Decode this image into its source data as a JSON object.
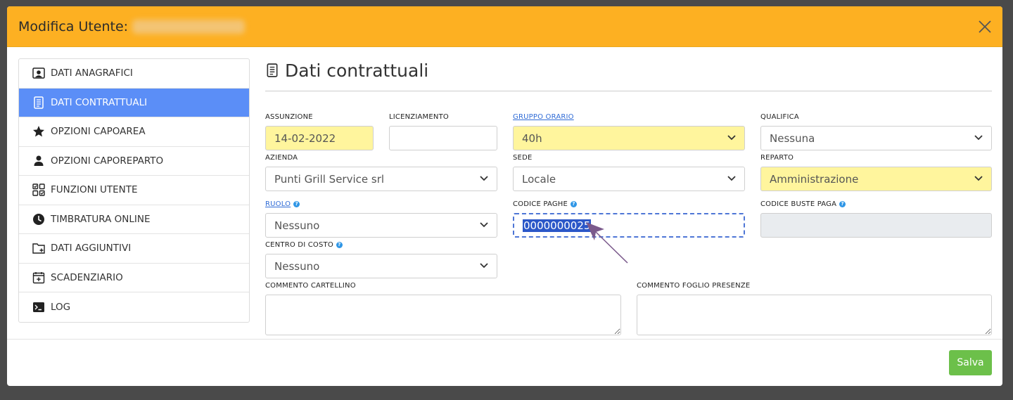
{
  "modal": {
    "title": "Modifica Utente:",
    "save_label": "Salva"
  },
  "sidebar": {
    "items": [
      {
        "label": "DATI ANAGRAFICI",
        "icon": "user-card-icon"
      },
      {
        "label": "DATI CONTRATTUALI",
        "icon": "document-list-icon",
        "active": true
      },
      {
        "label": "OPZIONI CAPOAREA",
        "icon": "star-icon"
      },
      {
        "label": "OPZIONI CAPOREPARTO",
        "icon": "person-icon"
      },
      {
        "label": "FUNZIONI UTENTE",
        "icon": "checkbox-grid-icon"
      },
      {
        "label": "TIMBRATURA ONLINE",
        "icon": "clock-icon"
      },
      {
        "label": "DATI AGGIUNTIVI",
        "icon": "folder-plus-icon"
      },
      {
        "label": "SCADENZIARIO",
        "icon": "calendar-plus-icon"
      },
      {
        "label": "LOG",
        "icon": "terminal-icon"
      }
    ]
  },
  "section": {
    "title": "Dati contrattuali"
  },
  "form": {
    "assunzione": {
      "label": "ASSUNZIONE",
      "value": "14-02-2022"
    },
    "licenziamento": {
      "label": "LICENZIAMENTO",
      "value": ""
    },
    "gruppo_orario": {
      "label": "GRUPPO ORARIO",
      "value": "40h"
    },
    "qualifica": {
      "label": "QUALIFICA",
      "value": "Nessuna"
    },
    "azienda": {
      "label": "AZIENDA",
      "value": "Punti Grill Service srl"
    },
    "sede": {
      "label": "SEDE",
      "value": "Locale"
    },
    "reparto": {
      "label": "REPARTO",
      "value": "Amministrazione"
    },
    "ruolo": {
      "label": "RUOLO",
      "value": "Nessuno"
    },
    "codice_paghe": {
      "label": "CODICE PAGHE",
      "value": "0000000025"
    },
    "codice_buste_paga": {
      "label": "CODICE BUSTE PAGA",
      "value": ""
    },
    "centro_di_costo": {
      "label": "CENTRO DI COSTO",
      "value": "Nessuno"
    },
    "commento_cartellino": {
      "label": "COMMENTO CARTELLINO"
    },
    "commento_foglio_presenze": {
      "label": "COMMENTO FOGLIO PRESENZE"
    }
  },
  "colors": {
    "header": "#fdb022",
    "active_nav": "#5b8ef7",
    "highlight_field": "#fff59d",
    "save_button": "#6cc04a",
    "link": "#2f6bd6"
  }
}
